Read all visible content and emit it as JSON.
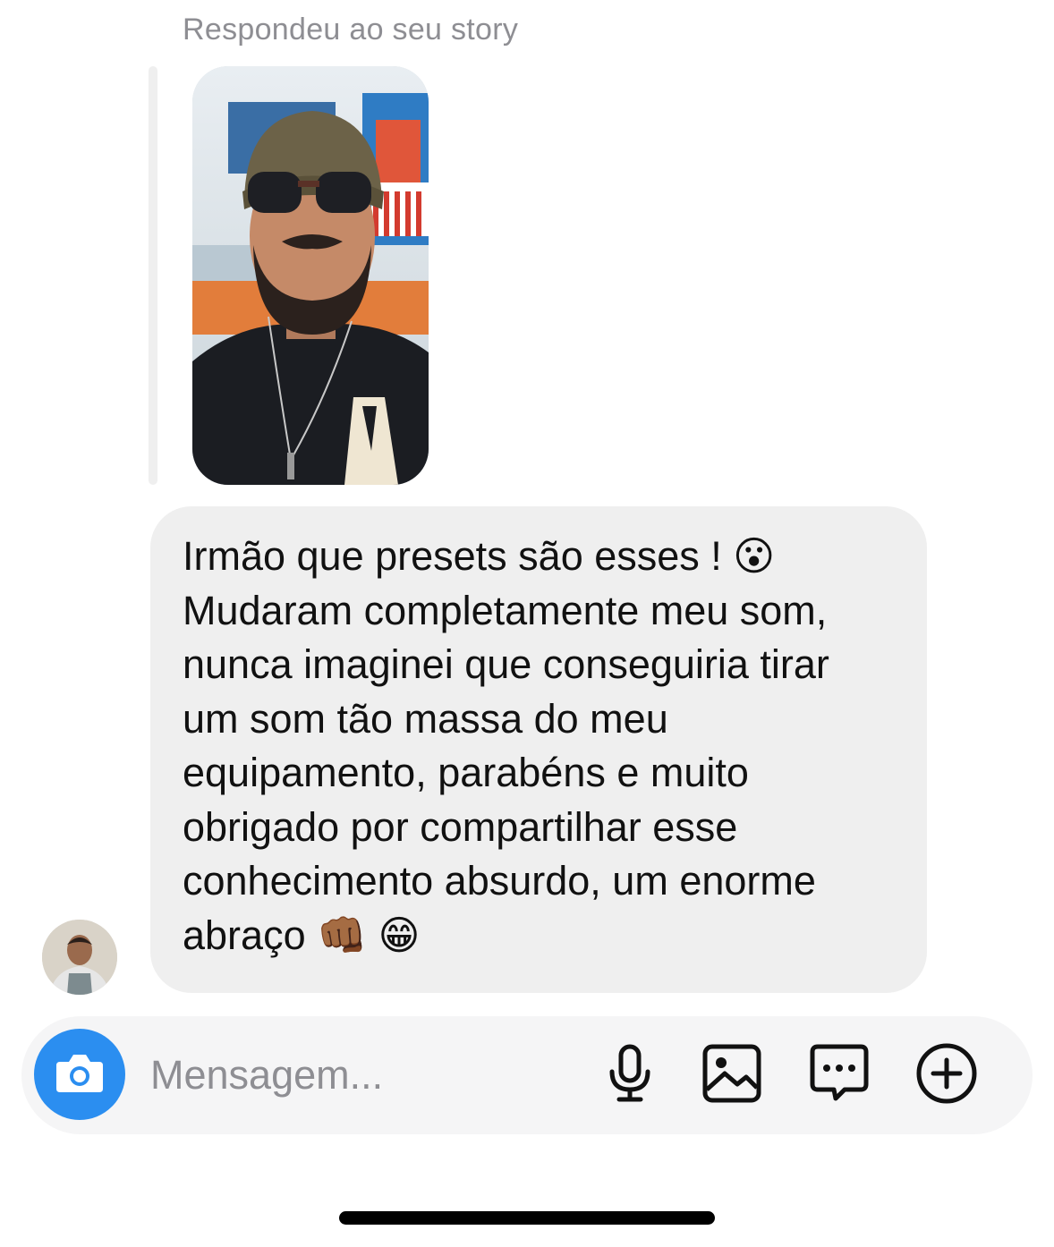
{
  "reply_context": {
    "label": "Respondeu ao seu story"
  },
  "message": {
    "text": "Irmão que presets são esses ! 😮\nMudaram completamente meu som,\nnunca imaginei que conseguiria tirar\num som tão massa do meu\nequipamento, parabéns e muito\nobrigado por compartilhar esse\nconhecimento absurdo, um enorme\nabraço 👊🏾 😁"
  },
  "composer": {
    "placeholder": "Mensagem...",
    "icons": [
      "camera-icon",
      "microphone-icon",
      "gallery-icon",
      "chat-sticker-icon",
      "add-icon"
    ],
    "camera_color": "#2b8ef0"
  }
}
